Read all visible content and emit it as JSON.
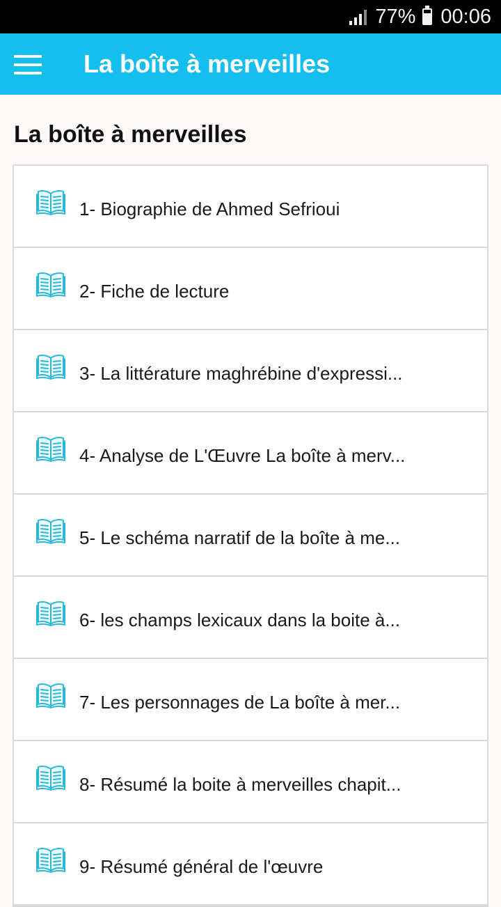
{
  "status_bar": {
    "battery": "77%",
    "time": "00:06",
    "signal_icon": "signal-icon",
    "battery_icon": "battery-icon"
  },
  "app_bar": {
    "title": "La boîte à merveilles",
    "menu_icon": "hamburger-menu-icon",
    "color": "#14bff0"
  },
  "main": {
    "heading": "La boîte à merveilles",
    "items": [
      {
        "label": "1- Biographie de Ahmed Sefrioui"
      },
      {
        "label": "2- Fiche de lecture"
      },
      {
        "label": "3- La littérature maghrébine d'expressi..."
      },
      {
        "label": "4- Analyse de L'Œuvre La boîte à merv..."
      },
      {
        "label": "5- Le schéma narratif de la boîte à me..."
      },
      {
        "label": "6- les champs lexicaux dans la boite à..."
      },
      {
        "label": "7- Les personnages de La boîte à mer..."
      },
      {
        "label": "8- Résumé la boite à merveilles chapit..."
      },
      {
        "label": "9- Résumé général de l'œuvre"
      }
    ],
    "item_icon": "open-book-icon",
    "icon_color": "#2ab8d8"
  }
}
